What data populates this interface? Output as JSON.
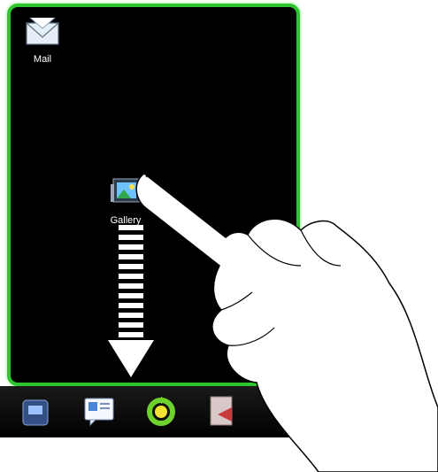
{
  "home_screen": {
    "apps": [
      {
        "label": "Mail",
        "icon": "mail-icon"
      },
      {
        "label": "Gallery",
        "icon": "gallery-icon"
      }
    ]
  },
  "dock": {
    "items": [
      {
        "icon": "phone-icon"
      },
      {
        "icon": "messages-icon"
      },
      {
        "icon": "sync-icon"
      },
      {
        "icon": "notes-icon"
      }
    ]
  },
  "colors": {
    "screen_border": "#2ec52e",
    "screen_background": "#000000"
  }
}
